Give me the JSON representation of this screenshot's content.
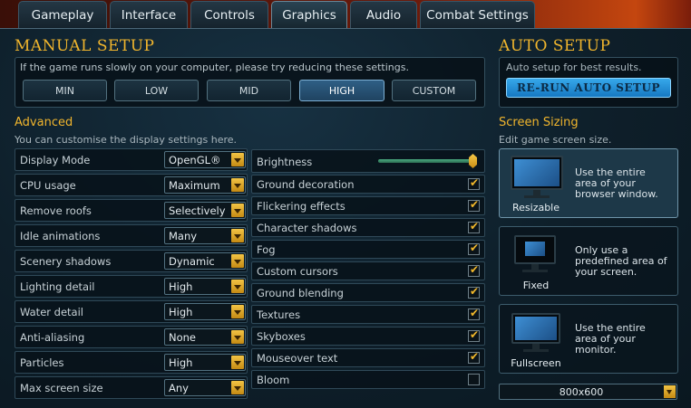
{
  "tabs": [
    {
      "label": "Gameplay"
    },
    {
      "label": "Interface"
    },
    {
      "label": "Controls"
    },
    {
      "label": "Graphics",
      "active": true
    },
    {
      "label": "Audio"
    },
    {
      "label": "Combat Settings"
    }
  ],
  "manual_setup": {
    "title": "MANUAL SETUP",
    "hint": "If the game runs slowly on your computer, please try reducing these settings.",
    "presets": [
      "MIN",
      "LOW",
      "MID",
      "HIGH",
      "CUSTOM"
    ],
    "selected_preset": "HIGH"
  },
  "auto_setup": {
    "title": "AUTO SETUP",
    "hint": "Auto setup for best results.",
    "button": "RE-RUN AUTO SETUP"
  },
  "advanced": {
    "title": "Advanced",
    "hint": "You can customise the display settings here.",
    "dropdowns": [
      {
        "label": "Display Mode",
        "value": "OpenGL®"
      },
      {
        "label": "CPU usage",
        "value": "Maximum"
      },
      {
        "label": "Remove roofs",
        "value": "Selectively"
      },
      {
        "label": "Idle animations",
        "value": "Many"
      },
      {
        "label": "Scenery shadows",
        "value": "Dynamic"
      },
      {
        "label": "Lighting detail",
        "value": "High"
      },
      {
        "label": "Water detail",
        "value": "High"
      },
      {
        "label": "Anti-aliasing",
        "value": "None"
      },
      {
        "label": "Particles",
        "value": "High"
      },
      {
        "label": "Max screen size",
        "value": "Any"
      }
    ],
    "brightness": {
      "label": "Brightness",
      "level": 1.0
    },
    "checkboxes": [
      {
        "label": "Ground decoration",
        "checked": true
      },
      {
        "label": "Flickering effects",
        "checked": true
      },
      {
        "label": "Character shadows",
        "checked": true
      },
      {
        "label": "Fog",
        "checked": true
      },
      {
        "label": "Custom cursors",
        "checked": true
      },
      {
        "label": "Ground blending",
        "checked": true
      },
      {
        "label": "Textures",
        "checked": true
      },
      {
        "label": "Skyboxes",
        "checked": true
      },
      {
        "label": "Mouseover text",
        "checked": true
      },
      {
        "label": "Bloom",
        "checked": false
      }
    ]
  },
  "screen_sizing": {
    "title": "Screen Sizing",
    "hint": "Edit game screen size.",
    "options": [
      {
        "name": "Resizable",
        "desc": [
          "Use the entire",
          "area of your",
          "browser window."
        ],
        "selected": true
      },
      {
        "name": "Fixed",
        "desc": [
          "Only use a",
          "predefined area of",
          "your screen."
        ],
        "selected": false
      },
      {
        "name": "Fullscreen",
        "desc": [
          "Use the entire",
          "area of your",
          "monitor."
        ],
        "selected": false
      }
    ],
    "resolution": "800x600"
  },
  "colors": {
    "accent_gold": "#f0b52d",
    "selected_blue": "#2f5f85",
    "auto_button": "#1f8fd8"
  }
}
